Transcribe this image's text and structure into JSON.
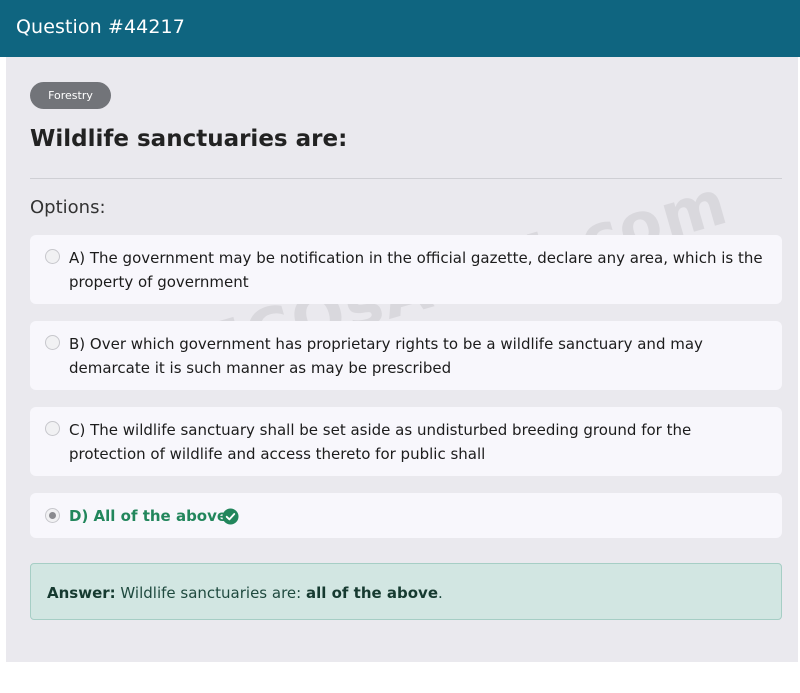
{
  "header": {
    "title": "Question #44217"
  },
  "question": {
    "category": "Forestry",
    "text": "Wildlife sanctuaries are:",
    "options_label": "Options:",
    "options": [
      {
        "label": "A) The government may be notification in the official gazette, declare any area, which is the property of government",
        "selected": false,
        "correct": false
      },
      {
        "label": "B) Over which government has proprietary rights to be a wildlife sanctuary and may demarcate it is such manner as may be prescribed",
        "selected": false,
        "correct": false
      },
      {
        "label": "C) The wildlife sanctuary shall be set aside as undisturbed breeding ground for the protection of wildlife and access thereto for public shall",
        "selected": false,
        "correct": false
      },
      {
        "label": "D) All of the above",
        "selected": true,
        "correct": true
      }
    ]
  },
  "answer": {
    "prefix": "Answer:",
    "body": " Wildlife sanctuaries are: ",
    "emphasis": "all of the above",
    "suffix": "."
  },
  "watermark": "MCQsAlert.com",
  "colors": {
    "header": "#0f6580",
    "correct": "#22865c",
    "answer_bg": "#d2e6e2"
  }
}
